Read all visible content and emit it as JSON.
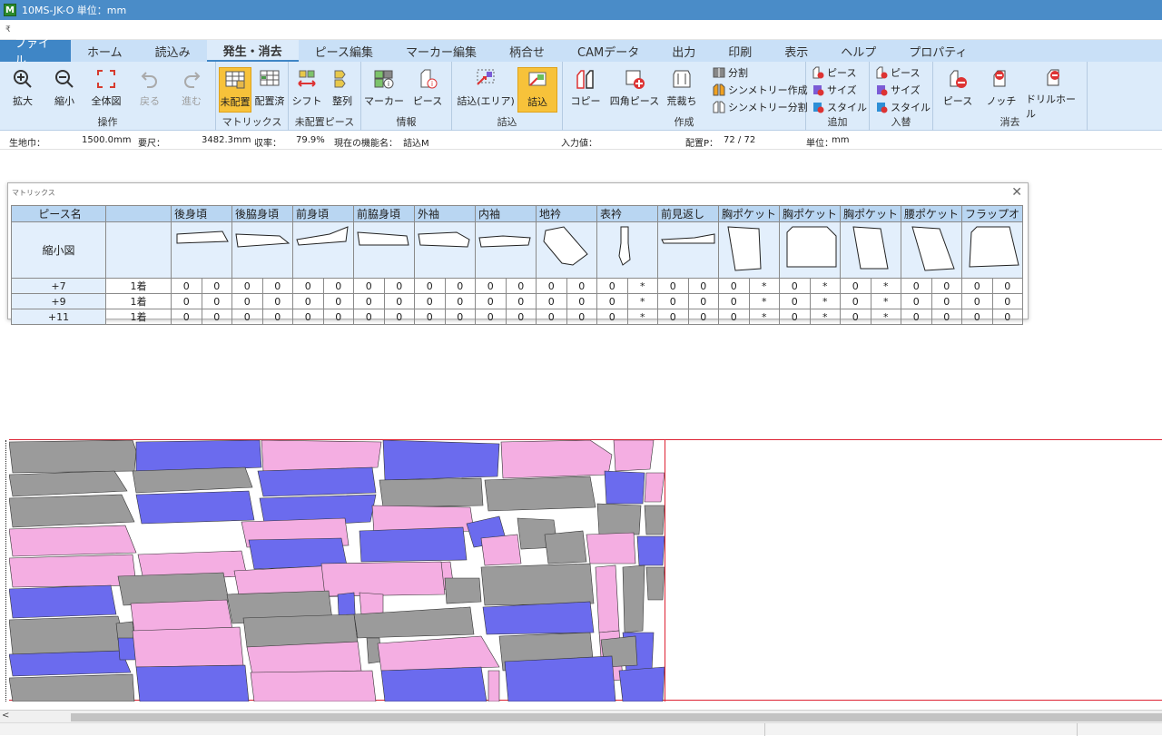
{
  "window": {
    "title": "10MS-JK-O  単位：mm",
    "app_icon_label": "M",
    "qat_label": "₹"
  },
  "menu_tabs": [
    "ファイル",
    "ホーム",
    "読込み",
    "発生・消去",
    "ピース編集",
    "マーカー編集",
    "柄合せ",
    "CAMデータ",
    "出力",
    "印刷",
    "表示",
    "ヘルプ",
    "プロパティ"
  ],
  "active_tab": "発生・消去",
  "ribbon": {
    "groups": [
      {
        "label": "操作",
        "buttons": [
          "拡大",
          "縮小",
          "全体図",
          "戻る",
          "進む"
        ]
      },
      {
        "label": "マトリックス",
        "buttons": [
          "未配置",
          "配置済"
        ]
      },
      {
        "label": "未配置ピース",
        "buttons": [
          "シフト",
          "整列"
        ]
      },
      {
        "label": "情報",
        "buttons": [
          "マーカー",
          "ピース"
        ]
      },
      {
        "label": "詰込",
        "buttons": [
          "詰込(エリア)",
          "詰込"
        ]
      },
      {
        "label": "作成",
        "buttons": [
          "コピー",
          "四角ピース",
          "荒裁ち"
        ],
        "small": [
          "分割",
          "シンメトリー作成",
          "シンメトリー分割"
        ]
      },
      {
        "label": "追加",
        "small": [
          "ピース",
          "サイズ",
          "スタイル"
        ]
      },
      {
        "label": "入替",
        "small": [
          "ピース",
          "サイズ",
          "スタイル"
        ]
      },
      {
        "label": "消去",
        "buttons": [
          "ピース",
          "ノッチ",
          "ドリルホール"
        ]
      }
    ]
  },
  "status": {
    "fabric_width_label": "生地巾：",
    "fabric_width_value": "1500.0mm",
    "required_length_label": "要尺：",
    "required_length_value": "3482.3mm",
    "yield_label": "収率：",
    "yield_value": "79.9%",
    "current_function_label": "現在の機能名：",
    "current_function_value": "詰込M",
    "input_label": "入力値：",
    "placed_label": "配置P：",
    "placed_value": "72 / 72",
    "unit_label": "単位：",
    "unit_value": "mm"
  },
  "matrix": {
    "title": "マトリックス",
    "header_label": "ピース名",
    "thumb_label": "縮小図",
    "pieces": [
      "後身頃",
      "後脇身頃",
      "前身頃",
      "前脇身頃",
      "外袖",
      "内袖",
      "地衿",
      "表衿",
      "前見返し",
      "胸ポケット",
      "胸ポケット",
      "胸ポケット",
      "腰ポケット",
      "フラップオ"
    ],
    "rows": [
      {
        "size": "+7",
        "qty": "1着",
        "cells": [
          "0",
          "0",
          "0",
          "0",
          "0",
          "0",
          "0",
          "0",
          "0",
          "0",
          "0",
          "0",
          "0",
          "0",
          "0",
          "*",
          "0",
          "0",
          "0",
          "*",
          "0",
          "*",
          "0",
          "*",
          "0",
          "0",
          "0",
          "0"
        ]
      },
      {
        "size": "+9",
        "qty": "1着",
        "cells": [
          "0",
          "0",
          "0",
          "0",
          "0",
          "0",
          "0",
          "0",
          "0",
          "0",
          "0",
          "0",
          "0",
          "0",
          "0",
          "*",
          "0",
          "0",
          "0",
          "*",
          "0",
          "*",
          "0",
          "*",
          "0",
          "0",
          "0",
          "0"
        ]
      },
      {
        "size": "+11",
        "qty": "1着",
        "cells": [
          "0",
          "0",
          "0",
          "0",
          "0",
          "0",
          "0",
          "0",
          "0",
          "0",
          "0",
          "0",
          "0",
          "0",
          "0",
          "*",
          "0",
          "0",
          "0",
          "*",
          "0",
          "*",
          "0",
          "*",
          "0",
          "0",
          "0",
          "0"
        ]
      }
    ]
  },
  "colors": {
    "gray": "#9b9b9b",
    "pink": "#f4aee2",
    "blue": "#6b6bee",
    "accent": "#3f86c6",
    "highlight": "#f7c23a"
  }
}
